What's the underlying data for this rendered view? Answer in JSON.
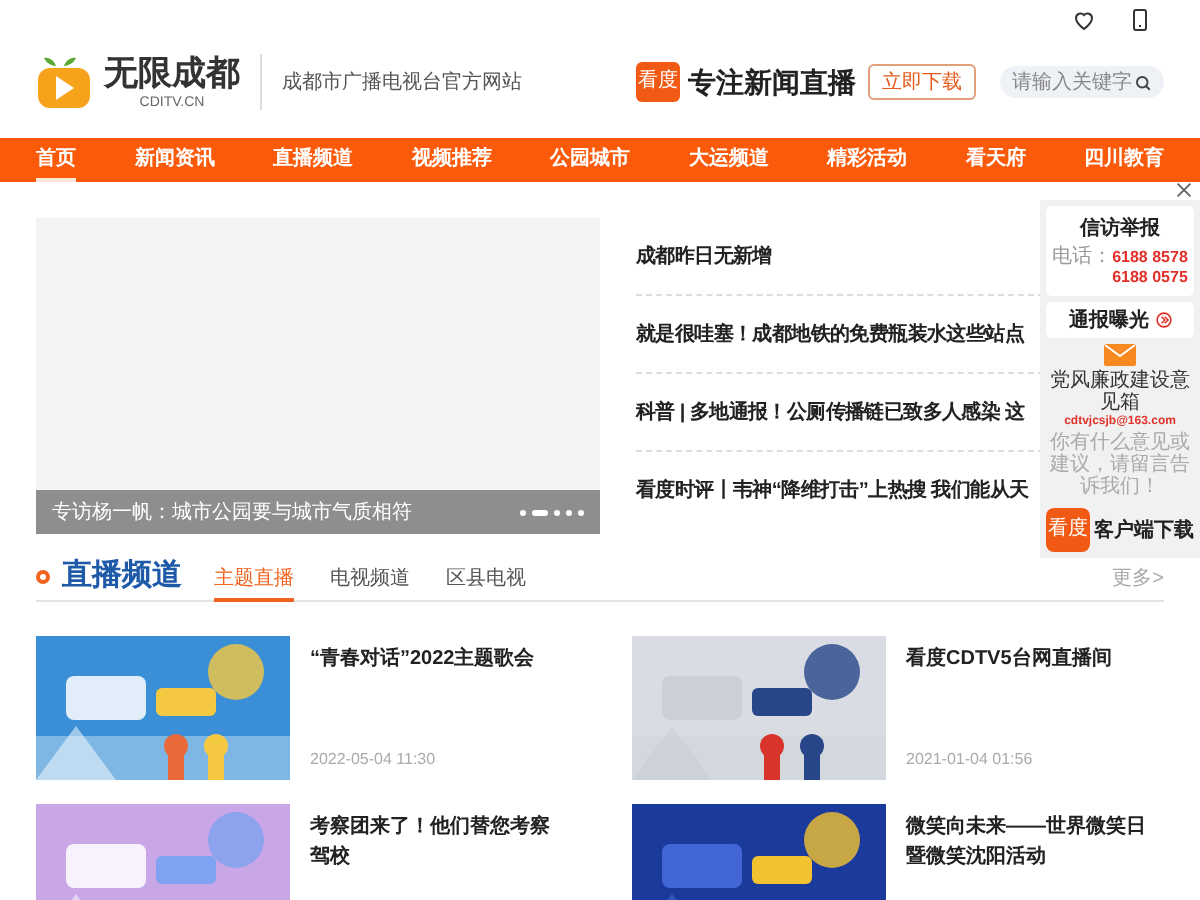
{
  "header": {
    "site_name": "无限成都",
    "domain": "CDITV.CN",
    "tagline": "成都市广播电视台官方网站",
    "app_badge": "看度",
    "slogan": "专注新闻直播",
    "download_button": "立即下载",
    "search": {
      "placeholder": "请输入关键字"
    }
  },
  "nav": [
    {
      "label": "首页",
      "selected": true
    },
    {
      "label": "新闻资讯",
      "selected": false
    },
    {
      "label": "直播频道",
      "selected": false
    },
    {
      "label": "视频推荐",
      "selected": false
    },
    {
      "label": "公园城市",
      "selected": false
    },
    {
      "label": "大运频道",
      "selected": false
    },
    {
      "label": "精彩活动",
      "selected": false
    },
    {
      "label": "看天府",
      "selected": false
    },
    {
      "label": "四川教育",
      "selected": false
    }
  ],
  "carousel": {
    "caption": "专访杨一帆：城市公园要与城市气质相符",
    "dots": [
      {
        "selected": false
      },
      {
        "selected": true
      },
      {
        "selected": false
      },
      {
        "selected": false
      },
      {
        "selected": false
      }
    ]
  },
  "news": [
    "成都昨日无新增",
    "就是很哇塞！成都地铁的免费瓶装水这些站点",
    "科普 | 多地通报！公厕传播链已致多人感染 这",
    "看度时评丨韦神“降维打击”上热搜 我们能从天"
  ],
  "sidebar": {
    "report_title": "信访举报",
    "phone_label": "电话：",
    "phones": [
      "6188 8578",
      "6188 0575"
    ],
    "expose_link": "通报曝光",
    "mailbox_title": "党风廉政建设意见箱",
    "email": "cdtvjcsjb@163.com",
    "mailbox_note": "你有什么意见或建议，请留言告诉我们！",
    "app_badge": "看度",
    "app_download": "客户端下载"
  },
  "section": {
    "title": "直播频道",
    "tabs": [
      {
        "label": "主题直播",
        "selected": true
      },
      {
        "label": "电视频道",
        "selected": false
      },
      {
        "label": "区县电视",
        "selected": false
      }
    ],
    "more": "更多>",
    "cards": [
      {
        "title": "“青春对话”2022主题歌会",
        "date": "2022-05-04 11:30"
      },
      {
        "title": "看度CDTV5台网直播间",
        "date": "2021-01-04 01:56"
      },
      {
        "title": "考察团来了！他们替您考察驾校"
      },
      {
        "title": "微笑向未来——世界微笑日暨微笑沈阳活动"
      }
    ]
  }
}
